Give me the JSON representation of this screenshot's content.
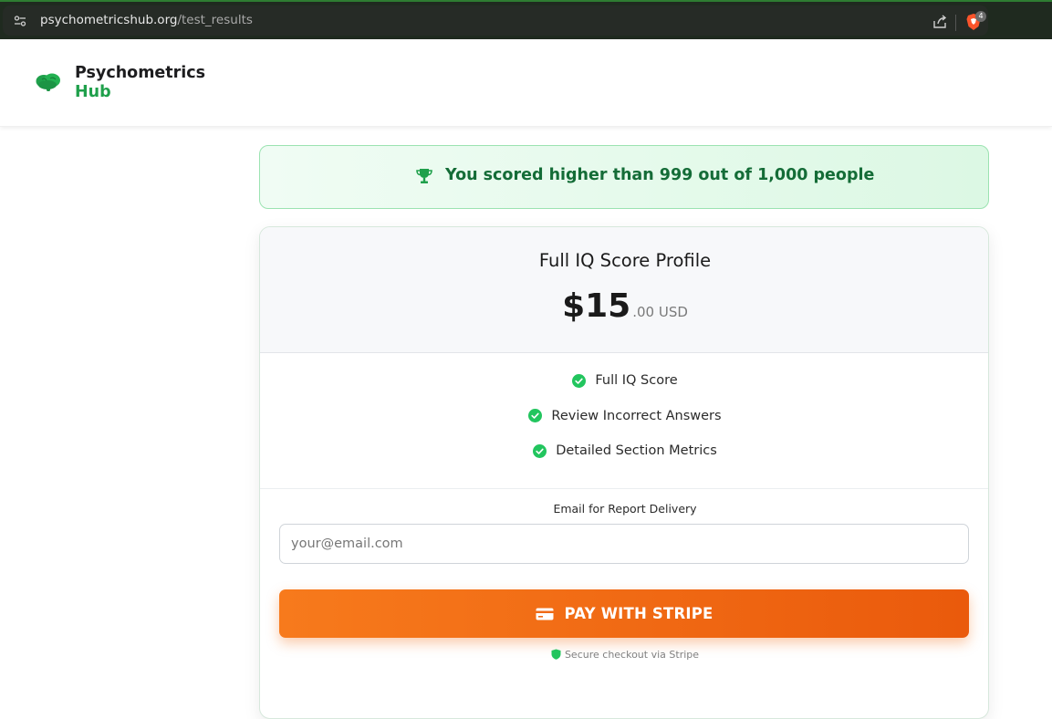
{
  "browser": {
    "url_domain": "psychometricshub.org",
    "url_path": "/test_results",
    "extension_badge": "4"
  },
  "header": {
    "logo_line1": "Psychometrics",
    "logo_line2": "Hub"
  },
  "banner": {
    "text": "You scored higher than 999 out of 1,000 people"
  },
  "card": {
    "title": "Full IQ Score Profile",
    "price_main": "$15",
    "price_suffix": ".00 USD",
    "features": [
      {
        "label": "Full IQ Score"
      },
      {
        "label": "Review Incorrect Answers"
      },
      {
        "label": "Detailed Section Metrics"
      }
    ],
    "email_label": "Email for Report Delivery",
    "email_placeholder": "your@email.com",
    "pay_label": "PAY WITH STRIPE",
    "secure_text": "Secure checkout via Stripe"
  },
  "colors": {
    "brand_green": "#1fa04b",
    "banner_text": "#146c37",
    "check_green": "#22c55e",
    "pay_orange": "#f77a1c"
  }
}
